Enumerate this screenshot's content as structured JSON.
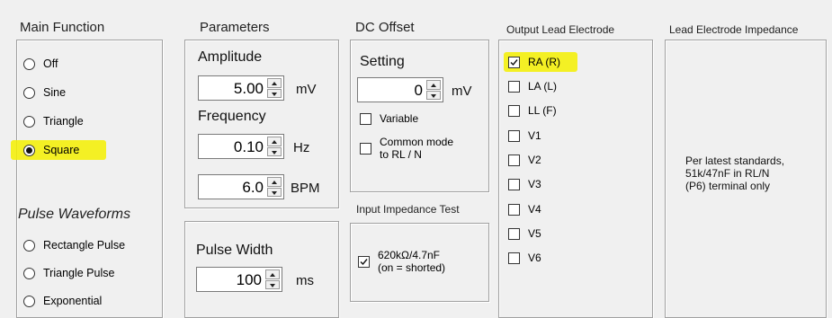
{
  "main_function": {
    "header": "Main Function",
    "options": [
      {
        "label": "Off",
        "selected": false
      },
      {
        "label": "Sine",
        "selected": false
      },
      {
        "label": "Triangle",
        "selected": false
      },
      {
        "label": "Square",
        "selected": true
      }
    ],
    "pulse_header": "Pulse Waveforms",
    "pulse_options": [
      {
        "label": "Rectangle Pulse",
        "selected": false
      },
      {
        "label": "Triangle Pulse",
        "selected": false
      },
      {
        "label": "Exponential",
        "selected": false
      }
    ]
  },
  "parameters": {
    "header": "Parameters",
    "amplitude_label": "Amplitude",
    "amplitude_value": "5.00",
    "amplitude_unit": "mV",
    "frequency_label": "Frequency",
    "frequency_value": "0.10",
    "frequency_unit": "Hz",
    "bpm_value": "6.0",
    "bpm_unit": "BPM",
    "pulse_width_label": "Pulse Width",
    "pulse_width_value": "100",
    "pulse_width_unit": "ms"
  },
  "dc_offset": {
    "header": "DC Offset",
    "setting_label": "Setting",
    "setting_value": "0",
    "setting_unit": "mV",
    "variable_label": "Variable",
    "variable_checked": false,
    "common_mode_line1": "Common mode",
    "common_mode_line2": "to RL / N",
    "common_mode_checked": false,
    "input_impedance_header": "Input Impedance Test",
    "impedance_line1": "620kΩ/4.7nF",
    "impedance_line2": "(on = shorted)",
    "impedance_checked": true
  },
  "output_lead": {
    "header": "Output Lead Electrode",
    "leads": [
      {
        "label": "RA (R)",
        "checked": true
      },
      {
        "label": "LA (L)",
        "checked": false
      },
      {
        "label": "LL (F)",
        "checked": false
      },
      {
        "label": "V1",
        "checked": false
      },
      {
        "label": "V2",
        "checked": false
      },
      {
        "label": "V3",
        "checked": false
      },
      {
        "label": "V4",
        "checked": false
      },
      {
        "label": "V5",
        "checked": false
      },
      {
        "label": "V6",
        "checked": false
      }
    ]
  },
  "lead_impedance": {
    "header": "Lead Electrode Impedance",
    "note_line1": "Per latest standards,",
    "note_line2": "51k/47nF in RL/N",
    "note_line3": "(P6) terminal only"
  },
  "colors": {
    "highlight": "#f4f000",
    "panel_bg": "#f0f0f0"
  }
}
